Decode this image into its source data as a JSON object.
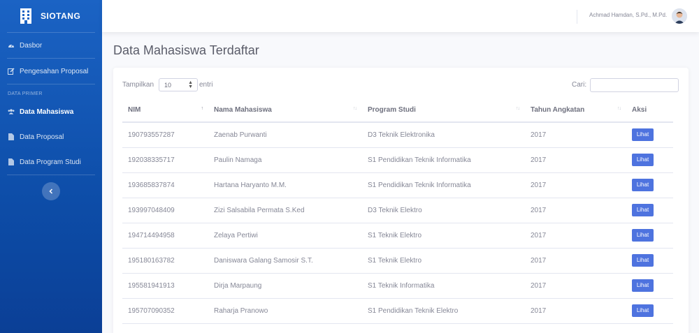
{
  "sidebar": {
    "brand": "SIOTANG",
    "items": [
      {
        "label": "Dasbor",
        "icon": "gauge-icon"
      },
      {
        "label": "Pengesahan Proposal",
        "icon": "pen-square-icon"
      }
    ],
    "section_heading": "DATA PRIMER",
    "primer_items": [
      {
        "label": "Data Mahasiswa",
        "icon": "users-icon",
        "active": true
      },
      {
        "label": "Data Proposal",
        "icon": "file-icon"
      },
      {
        "label": "Data Program Studi",
        "icon": "file-icon"
      }
    ],
    "toggle_icon": "chevron-left-icon"
  },
  "topbar": {
    "user_name": "Achmad Hamdan, S.Pd., M.Pd."
  },
  "page": {
    "title": "Data Mahasiswa Terdaftar"
  },
  "table_controls": {
    "show_label": "Tampilkan",
    "show_value": "10",
    "show_after": "entri",
    "search_label": "Cari:",
    "search_value": ""
  },
  "table": {
    "columns": [
      "NIM",
      "Nama Mahasiswa",
      "Program Studi",
      "Tahun Angkatan",
      "Aksi"
    ],
    "rows": [
      {
        "nim": "190793557287",
        "nama": "Zaenab Purwanti",
        "prodi": "D3 Teknik Elektronika",
        "tahun": "2017",
        "aksi": "Lihat"
      },
      {
        "nim": "192038335717",
        "nama": "Paulin Namaga",
        "prodi": "S1 Pendidikan Teknik Informatika",
        "tahun": "2017",
        "aksi": "Lihat"
      },
      {
        "nim": "193685837874",
        "nama": "Hartana Haryanto M.M.",
        "prodi": "S1 Pendidikan Teknik Informatika",
        "tahun": "2017",
        "aksi": "Lihat"
      },
      {
        "nim": "193997048409",
        "nama": "Zizi Salsabila Permata S.Ked",
        "prodi": "D3 Teknik Elektro",
        "tahun": "2017",
        "aksi": "Lihat"
      },
      {
        "nim": "194714494958",
        "nama": "Zelaya Pertiwi",
        "prodi": "S1 Teknik Elektro",
        "tahun": "2017",
        "aksi": "Lihat"
      },
      {
        "nim": "195180163782",
        "nama": "Daniswara Galang Samosir S.T.",
        "prodi": "S1 Teknik Elektro",
        "tahun": "2017",
        "aksi": "Lihat"
      },
      {
        "nim": "195581941913",
        "nama": "Dirja Marpaung",
        "prodi": "S1 Teknik Informatika",
        "tahun": "2017",
        "aksi": "Lihat"
      },
      {
        "nim": "195707090352",
        "nama": "Raharja Pranowo",
        "prodi": "S1 Pendidikan Teknik Elektro",
        "tahun": "2017",
        "aksi": "Lihat"
      }
    ]
  },
  "colors": {
    "sidebar": "#1b63c4",
    "primary_button": "#4e73df",
    "background": "#f8f9fc"
  }
}
